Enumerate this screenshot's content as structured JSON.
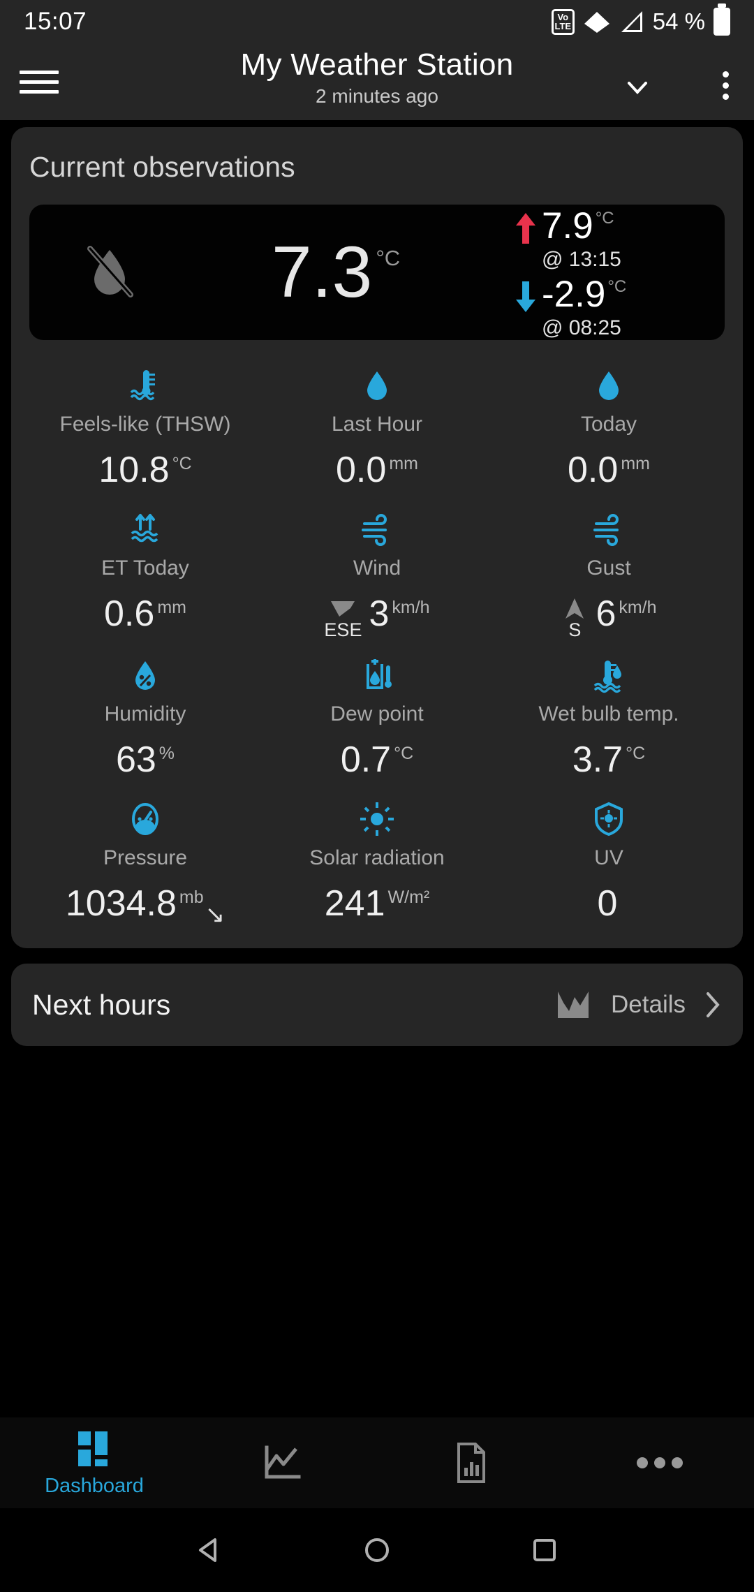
{
  "status_bar": {
    "time": "15:07",
    "network_badge": "VoLTE",
    "volte_top": "Vo",
    "volte_bottom": "LTE",
    "battery_percent": "54 %",
    "icons": [
      "volte-icon",
      "wifi-icon",
      "cellular-signal-icon",
      "battery-icon"
    ]
  },
  "app_bar": {
    "menu_icon": "hamburger-menu-icon",
    "title": "My Weather Station",
    "subtitle": "2 minutes ago",
    "dropdown_icon": "chevron-down-icon",
    "overflow_icon": "kebab-menu-icon"
  },
  "observations": {
    "card_title": "Current observations",
    "hero": {
      "condition_icon": "no-rain-droplet-slashed-icon",
      "temperature": "7.3",
      "temperature_unit": "°C",
      "high": {
        "arrow_icon": "arrow-up-icon",
        "value": "7.9",
        "unit": "°C",
        "time": "@ 13:15",
        "color": "#E8334C"
      },
      "low": {
        "arrow_icon": "arrow-down-icon",
        "value": "-2.9",
        "unit": "°C",
        "time": "@ 08:25",
        "color": "#29A8DC"
      }
    },
    "metrics": [
      {
        "icon": "thermometer-water-icon",
        "label": "Feels-like (THSW)",
        "value": "10.8",
        "unit": "°C"
      },
      {
        "icon": "water-droplet-icon",
        "label": "Last Hour",
        "value": "0.0",
        "unit": "mm"
      },
      {
        "icon": "water-droplet-icon",
        "label": "Today",
        "value": "0.0",
        "unit": "mm"
      },
      {
        "icon": "evapotranspiration-icon",
        "label": "ET Today",
        "value": "0.6",
        "unit": "mm"
      },
      {
        "icon": "wind-icon",
        "label": "Wind",
        "value": "3",
        "unit": "km/h",
        "direction": "ESE",
        "direction_icon": "wind-direction-arrow-icon"
      },
      {
        "icon": "wind-icon",
        "label": "Gust",
        "value": "6",
        "unit": "km/h",
        "direction": "S",
        "direction_icon": "wind-direction-arrow-icon"
      },
      {
        "icon": "humidity-droplet-percent-icon",
        "label": "Humidity",
        "value": "63",
        "unit": "%"
      },
      {
        "icon": "dew-point-icon",
        "label": "Dew point",
        "value": "0.7",
        "unit": "°C"
      },
      {
        "icon": "wet-bulb-thermometer-icon",
        "label": "Wet bulb temp.",
        "value": "3.7",
        "unit": "°C"
      },
      {
        "icon": "pressure-gauge-icon",
        "label": "Pressure",
        "value": "1034.8",
        "unit": "mb",
        "trend": "↘"
      },
      {
        "icon": "sun-icon",
        "label": "Solar radiation",
        "value": "241",
        "unit": "W/m²"
      },
      {
        "icon": "uv-shield-icon",
        "label": "UV",
        "value": "0",
        "unit": ""
      }
    ],
    "accent_color": "#29A8DC"
  },
  "next_hours": {
    "title": "Next hours",
    "chart_icon": "line-chart-icon",
    "details_label": "Details",
    "chevron_icon": "chevron-right-icon"
  },
  "bottom_nav": {
    "items": [
      {
        "icon": "dashboard-grid-icon",
        "label": "Dashboard",
        "active": true
      },
      {
        "icon": "line-chart-icon",
        "label": "",
        "active": false
      },
      {
        "icon": "report-document-icon",
        "label": "",
        "active": false
      },
      {
        "icon": "more-dots-icon",
        "label": "",
        "active": false
      }
    ],
    "active_color": "#29A8DC"
  },
  "system_nav": {
    "back_icon": "triangle-back-icon",
    "home_icon": "circle-home-icon",
    "recents_icon": "square-recents-icon"
  }
}
